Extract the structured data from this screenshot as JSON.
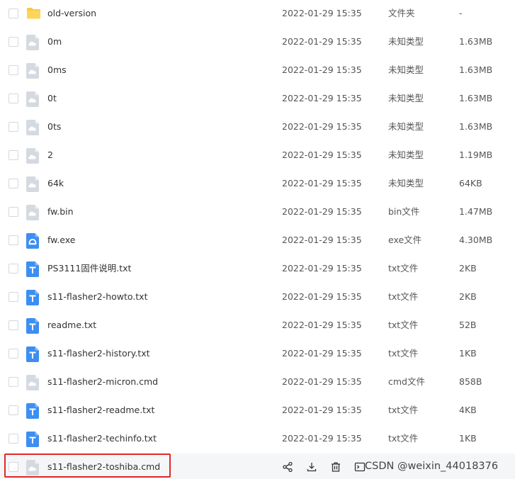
{
  "files": [
    {
      "name": "old-version",
      "date": "2022-01-29 15:35",
      "type": "文件夹",
      "size": "-",
      "icon": "folder-icon"
    },
    {
      "name": "0m",
      "date": "2022-01-29 15:35",
      "type": "未知类型",
      "size": "1.63MB",
      "icon": "unknown-file-icon"
    },
    {
      "name": "0ms",
      "date": "2022-01-29 15:35",
      "type": "未知类型",
      "size": "1.63MB",
      "icon": "unknown-file-icon"
    },
    {
      "name": "0t",
      "date": "2022-01-29 15:35",
      "type": "未知类型",
      "size": "1.63MB",
      "icon": "unknown-file-icon"
    },
    {
      "name": "0ts",
      "date": "2022-01-29 15:35",
      "type": "未知类型",
      "size": "1.63MB",
      "icon": "unknown-file-icon"
    },
    {
      "name": "2",
      "date": "2022-01-29 15:35",
      "type": "未知类型",
      "size": "1.19MB",
      "icon": "unknown-file-icon"
    },
    {
      "name": "64k",
      "date": "2022-01-29 15:35",
      "type": "未知类型",
      "size": "64KB",
      "icon": "unknown-file-icon"
    },
    {
      "name": "fw.bin",
      "date": "2022-01-29 15:35",
      "type": "bin文件",
      "size": "1.47MB",
      "icon": "unknown-file-icon"
    },
    {
      "name": "fw.exe",
      "date": "2022-01-29 15:35",
      "type": "exe文件",
      "size": "4.30MB",
      "icon": "exe-file-icon"
    },
    {
      "name": "PS3111固件说明.txt",
      "date": "2022-01-29 15:35",
      "type": "txt文件",
      "size": "2KB",
      "icon": "text-file-icon"
    },
    {
      "name": "s11-flasher2-howto.txt",
      "date": "2022-01-29 15:35",
      "type": "txt文件",
      "size": "2KB",
      "icon": "text-file-icon"
    },
    {
      "name": "readme.txt",
      "date": "2022-01-29 15:35",
      "type": "txt文件",
      "size": "52B",
      "icon": "text-file-icon"
    },
    {
      "name": "s11-flasher2-history.txt",
      "date": "2022-01-29 15:35",
      "type": "txt文件",
      "size": "1KB",
      "icon": "text-file-icon"
    },
    {
      "name": "s11-flasher2-micron.cmd",
      "date": "2022-01-29 15:35",
      "type": "cmd文件",
      "size": "858B",
      "icon": "unknown-file-icon"
    },
    {
      "name": "s11-flasher2-readme.txt",
      "date": "2022-01-29 15:35",
      "type": "txt文件",
      "size": "4KB",
      "icon": "text-file-icon"
    },
    {
      "name": "s11-flasher2-techinfo.txt",
      "date": "2022-01-29 15:35",
      "type": "txt文件",
      "size": "1KB",
      "icon": "text-file-icon"
    }
  ],
  "hovered_file": {
    "name": "s11-flasher2-toshiba.cmd",
    "icon": "unknown-file-icon",
    "actions": [
      "share-icon",
      "download-icon",
      "delete-icon",
      "more-icon"
    ]
  },
  "watermark": "CSDN @weixin_44018376",
  "colors": {
    "folder": "#fcc93f",
    "unknown": "#d5dae1",
    "text": "#3d8ef2",
    "exe": "#3d8ef2",
    "highlight": "#e02828",
    "hover_bg": "#f5f6f8"
  }
}
